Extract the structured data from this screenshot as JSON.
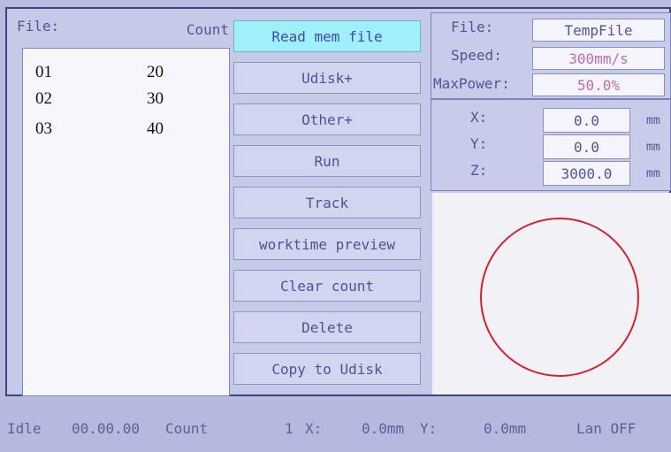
{
  "file_panel": {
    "file_label": "File:",
    "count_label": "Count",
    "rows": [
      {
        "name": "01",
        "count": "20"
      },
      {
        "name": "02",
        "count": "30"
      },
      {
        "name": "03",
        "count": "40"
      }
    ]
  },
  "buttons": {
    "read_mem_file": "Read mem file",
    "udisk_plus": "Udisk+",
    "other_plus": "Other+",
    "run": "Run",
    "track": "Track",
    "worktime_preview": "worktime preview",
    "clear_count": "Clear count",
    "delete": "Delete",
    "copy_to_udisk": "Copy to Udisk"
  },
  "file_info": {
    "file_label": "File:",
    "file_value": "TempFile",
    "speed_label": "Speed:",
    "speed_value": "300mm/s",
    "maxpower_label": "MaxPower:",
    "maxpower_value": "50.0%"
  },
  "position": {
    "x_label": "X:",
    "x_value": "0.0",
    "y_label": "Y:",
    "y_value": "0.0",
    "z_label": "Z:",
    "z_value": "3000.0",
    "unit": "mm"
  },
  "status": {
    "state": "Idle",
    "time": "00.00.00",
    "count_label": "Count",
    "count_value": "1",
    "x_label": "X:",
    "x_value": "0.0mm",
    "y_label": "Y:",
    "y_value": "0.0mm",
    "lan": "Lan OFF"
  },
  "colors": {
    "active_button": "#9ff0fb",
    "preview_circle": "#d41f2d"
  }
}
